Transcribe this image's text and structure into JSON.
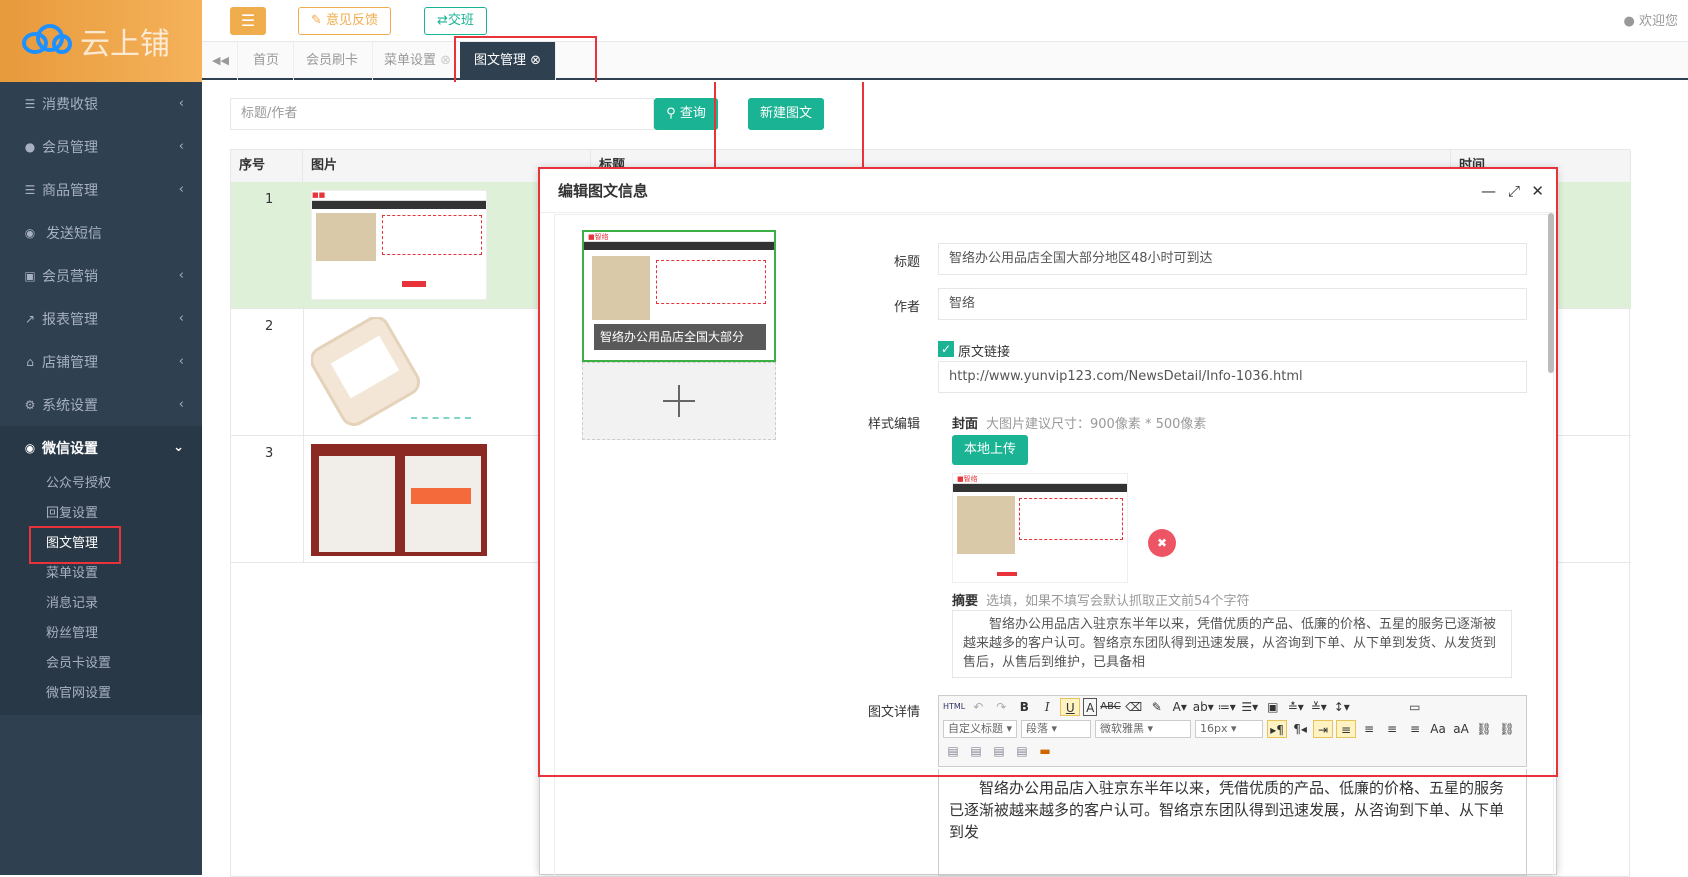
{
  "brand": {
    "name": "云上铺"
  },
  "sidebar": {
    "items": [
      {
        "label": "消费收银",
        "icon": "list-icon"
      },
      {
        "label": "会员管理",
        "icon": "user-icon"
      },
      {
        "label": "商品管理",
        "icon": "list-icon"
      },
      {
        "label": "发送短信",
        "icon": "comment-icon"
      },
      {
        "label": "会员营销",
        "icon": "briefcase-icon"
      },
      {
        "label": "报表管理",
        "icon": "chart-icon"
      },
      {
        "label": "店铺管理",
        "icon": "bank-icon"
      },
      {
        "label": "系统设置",
        "icon": "gears-icon"
      },
      {
        "label": "微信设置",
        "icon": "wechat-icon"
      }
    ],
    "sub_items": [
      "公众号授权",
      "回复设置",
      "图文管理",
      "菜单设置",
      "消息记录",
      "粉丝管理",
      "会员卡设置",
      "微官网设置"
    ]
  },
  "topbar": {
    "feedback": "意见反馈",
    "shift": "交班",
    "welcome": "欢迎您"
  },
  "tabs": [
    "首页",
    "会员刷卡",
    "菜单设置",
    "图文管理"
  ],
  "search": {
    "placeholder": "标题/作者",
    "button": "查询",
    "new_button": "新建图文"
  },
  "table": {
    "headers": [
      "序号",
      "图片",
      "标题",
      "时间"
    ],
    "rows": [
      {
        "num": "1"
      },
      {
        "num": "2"
      },
      {
        "num": "3"
      }
    ]
  },
  "modal": {
    "title": "编辑图文信息",
    "cover_caption": "智络办公用品店全国大部分",
    "title_label": "标题",
    "title_value": "智络办公用品店全国大部分地区48小时可到达",
    "author_label": "作者",
    "author_value": "智络",
    "origin_label": "原文链接",
    "origin_url": "http://www.yunvip123.com/NewsDetail/Info-1036.html",
    "style_label": "样式编辑",
    "cover_label": "封面",
    "cover_hint": "大图片建议尺寸：900像素 * 500像素",
    "upload_button": "本地上传",
    "summary_label": "摘要",
    "summary_hint": "选填，如果不填写会默认抓取正文前54个字符",
    "summary_text": "智络办公用品店入驻京东半年以来，凭借优质的产品、低廉的价格、五星的服务已逐渐被越来越多的客户认可。智络京东团队得到迅速发展，从咨询到下单、从下单到发货、从发货到售后，从售后到维护，已具备相",
    "detail_label": "图文详情",
    "editor": {
      "font_style": "自定义标题",
      "paragraph": "段落",
      "font_family": "微软雅黑",
      "font_size": "16px"
    },
    "body_text": "智络办公用品店入驻京东半年以来，凭借优质的产品、低廉的价格、五星的服务已逐渐被越来越多的客户认可。智络京东团队得到迅速发展，从咨询到下单、从下单到发"
  },
  "colors": {
    "sidebar": "#2f4050",
    "accent": "#1ab394",
    "warning": "#f0ad4e",
    "highlight": "#e8333a"
  }
}
